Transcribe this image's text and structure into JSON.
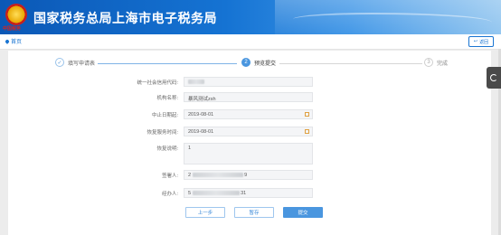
{
  "header": {
    "title": "国家税务总局上海市电子税务局",
    "emblem_text": "中国税务"
  },
  "breadcrumb": {
    "home": "首页",
    "back": "返回"
  },
  "steps": [
    {
      "num": "✓",
      "label": "填写申请表",
      "state": "done"
    },
    {
      "num": "2",
      "label": "预览提交",
      "state": "active"
    },
    {
      "num": "3",
      "label": "完成",
      "state": "todo"
    }
  ],
  "form": {
    "credit_code": {
      "label": "统一社会信用代码:"
    },
    "org_name": {
      "label": "机构名称:",
      "value": "暴风测试zsh"
    },
    "suspend_date": {
      "label": "中止日期起:",
      "value": "2019-08-01"
    },
    "resume_date": {
      "label": "恢复服务时间:",
      "value": "2019-08-01"
    },
    "reason": {
      "label": "恢复说明:",
      "value": "1"
    },
    "signer": {
      "label": "签署人:",
      "prefix": "2",
      "suffix": "9"
    },
    "handler": {
      "label": "经办人:",
      "prefix": "5",
      "suffix": "31"
    }
  },
  "buttons": {
    "prev": "上一步",
    "save": "暂存",
    "submit": "提交"
  },
  "colors": {
    "brand": "#1573d3",
    "accent": "#4a96df"
  }
}
